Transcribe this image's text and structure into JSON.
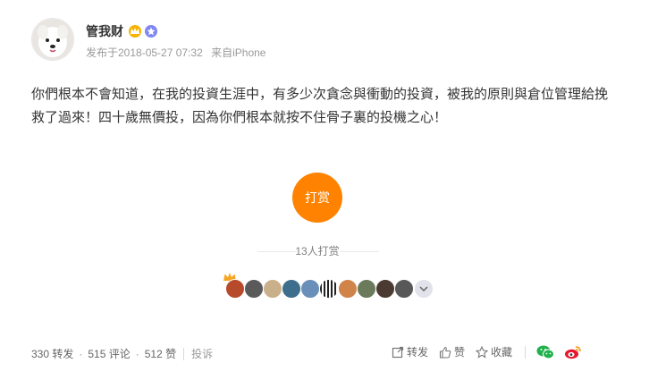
{
  "author": {
    "name": "管我财",
    "meta_time": "发布于2018-05-27 07:32",
    "meta_source": "来自iPhone"
  },
  "post": {
    "text": "你們根本不會知道，在我的投資生涯中，有多少次貪念與衝動的投資，被我的原則與倉位管理給挽救了過來！四十歲無價投，因為你們根本就按不住骨子裏的投機之心！"
  },
  "reward": {
    "button_label": "打赏",
    "count_label": "13人打赏",
    "donor_colors": [
      "#b84a2c",
      "#5a5a5a",
      "#c9b08a",
      "#3d6e8c",
      "#6a8fb8",
      "#2b2b2b",
      "#d0844a",
      "#6b7a5a",
      "#4a3a32",
      "#585858"
    ]
  },
  "footer": {
    "reposts": "330 转发",
    "comments": "515 评论",
    "likes": "512 赞",
    "dot": "·",
    "complain": "投诉",
    "repost_label": "转发",
    "like_label": "赞",
    "fav_label": "收藏"
  },
  "colors": {
    "accent": "#ff8200",
    "wechat": "#22b14c",
    "weibo": "#e6162d"
  }
}
